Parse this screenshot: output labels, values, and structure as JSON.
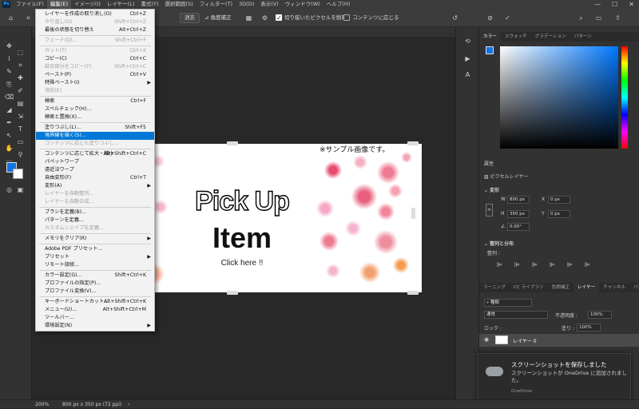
{
  "menubar": {
    "app_icon": "Ps",
    "items": [
      "ファイル(F)",
      "編集(E)",
      "イメージ(I)",
      "レイヤー(L)",
      "書式(Y)",
      "選択範囲(S)",
      "フィルター(T)",
      "3D(D)",
      "表示(V)",
      "ウィンドウ(W)",
      "ヘルプ(H)"
    ],
    "active_index": 1
  },
  "options_bar": {
    "clear_label": "消去",
    "straighten_label": "角度補正",
    "delete_cropped_label": "切り抜いたピクセルを削除",
    "delete_cropped_checked": true,
    "content_aware_label": "コンテンツに応じる",
    "content_aware_checked": false
  },
  "edit_menu": {
    "items": [
      {
        "label": "レイヤーを作成の取り消し(O)",
        "shortcut": "Ctrl+Z",
        "disabled": false
      },
      {
        "label": "やり直し(O)",
        "shortcut": "Shift+Ctrl+Z",
        "disabled": true
      },
      {
        "label": "最後の状態を切り替え",
        "shortcut": "Alt+Ctrl+Z",
        "disabled": false
      },
      {
        "sep": true
      },
      {
        "label": "フェード(D)...",
        "shortcut": "Shift+Ctrl+F",
        "disabled": true
      },
      {
        "sep": true
      },
      {
        "label": "カット(T)",
        "shortcut": "Ctrl+X",
        "disabled": true
      },
      {
        "label": "コピー(C)",
        "shortcut": "Ctrl+C",
        "disabled": false
      },
      {
        "label": "結合部分をコピー(Y)",
        "shortcut": "Shift+Ctrl+C",
        "disabled": true
      },
      {
        "label": "ペースト(P)",
        "shortcut": "Ctrl+V",
        "disabled": false
      },
      {
        "label": "特殊ペースト(I)",
        "shortcut": "",
        "disabled": false,
        "submenu": true
      },
      {
        "label": "消去(E)",
        "shortcut": "",
        "disabled": true
      },
      {
        "sep": true
      },
      {
        "label": "検索",
        "shortcut": "Ctrl+F",
        "disabled": false
      },
      {
        "label": "スペルチェック(H)...",
        "shortcut": "",
        "disabled": false
      },
      {
        "label": "検索と置換(X)...",
        "shortcut": "",
        "disabled": false
      },
      {
        "sep": true
      },
      {
        "label": "塗りつぶし(L)...",
        "shortcut": "Shift+F5",
        "disabled": false
      },
      {
        "label": "境界線を描く(S)...",
        "shortcut": "",
        "disabled": false,
        "highlighted": true
      },
      {
        "label": "コンテンツに応じた塗りつぶし...",
        "shortcut": "",
        "disabled": true
      },
      {
        "sep": true
      },
      {
        "label": "コンテンツに応じて拡大・縮小",
        "shortcut": "Alt+Shift+Ctrl+C",
        "disabled": false
      },
      {
        "label": "パペットワープ",
        "shortcut": "",
        "disabled": false
      },
      {
        "label": "遠近法ワープ",
        "shortcut": "",
        "disabled": false
      },
      {
        "label": "自由変形(F)",
        "shortcut": "Ctrl+T",
        "disabled": false
      },
      {
        "label": "変形(A)",
        "shortcut": "",
        "disabled": false,
        "submenu": true
      },
      {
        "label": "レイヤーを自動整列...",
        "shortcut": "",
        "disabled": true
      },
      {
        "label": "レイヤーを自動合成...",
        "shortcut": "",
        "disabled": true
      },
      {
        "sep": true
      },
      {
        "label": "ブラシを定義(B)...",
        "shortcut": "",
        "disabled": false
      },
      {
        "label": "パターンを定義...",
        "shortcut": "",
        "disabled": false
      },
      {
        "label": "カスタムシェイプを定義...",
        "shortcut": "",
        "disabled": true
      },
      {
        "sep": true
      },
      {
        "label": "メモリをクリア(R)",
        "shortcut": "",
        "disabled": false,
        "submenu": true
      },
      {
        "sep": true
      },
      {
        "label": "Adobe PDF プリセット...",
        "shortcut": "",
        "disabled": false
      },
      {
        "label": "プリセット",
        "shortcut": "",
        "disabled": false,
        "submenu": true
      },
      {
        "label": "リモート接続...",
        "shortcut": "",
        "disabled": false
      },
      {
        "sep": true
      },
      {
        "label": "カラー設定(G)...",
        "shortcut": "Shift+Ctrl+K",
        "disabled": false
      },
      {
        "label": "プロファイルの指定(P)...",
        "shortcut": "",
        "disabled": false
      },
      {
        "label": "プロファイル変換(V)...",
        "shortcut": "",
        "disabled": false
      },
      {
        "sep": true
      },
      {
        "label": "キーボードショートカット...",
        "shortcut": "Alt+Shift+Ctrl+K",
        "disabled": false
      },
      {
        "label": "メニュー(U)...",
        "shortcut": "Alt+Shift+Ctrl+M",
        "disabled": false
      },
      {
        "label": "ツールバー...",
        "shortcut": "",
        "disabled": false
      },
      {
        "label": "環境設定(N)",
        "shortcut": "",
        "disabled": false,
        "submenu": true
      }
    ]
  },
  "document": {
    "line1": "Pick Up",
    "line2": "Item",
    "line3": "Click here !!",
    "note": "※サンプル画像です。"
  },
  "color_panel": {
    "tabs": [
      "カラー",
      "スウォッチ",
      "グラデーション",
      "パターン"
    ],
    "fg_color": "#1473e6",
    "bg_color": "#ffffff"
  },
  "properties_panel": {
    "title": "属性",
    "layer_type": "ピクセルレイヤー",
    "transform_label": "変形",
    "w_label": "W",
    "w_value": "800 px",
    "h_label": "H",
    "h_value": "350 px",
    "x_label": "X",
    "x_value": "0 px",
    "y_label": "Y",
    "y_value": "0 px",
    "angle_value": "0.00°",
    "align_label": "整列と分布",
    "align_sub": "整列 :"
  },
  "layers_panel": {
    "tabs": [
      "ラーニング",
      "CC ライブラリ",
      "色調補正",
      "レイヤー",
      "チャンネル",
      "パス"
    ],
    "active_tab": 3,
    "kind_filter": "種類",
    "blend_mode": "通常",
    "opacity_label": "不透明度 :",
    "opacity_value": "100%",
    "lock_label": "ロック :",
    "fill_label": "塗り :",
    "fill_value": "100%",
    "layer_name": "レイヤー 0"
  },
  "toast": {
    "title": "スクリーンショットを保存しました",
    "body": "スクリーンショットが OneDrive に追加されました。",
    "source": "OneDrive"
  },
  "status": {
    "zoom": "200%",
    "doc_info": "800 px x 350 px (72 ppi)"
  }
}
